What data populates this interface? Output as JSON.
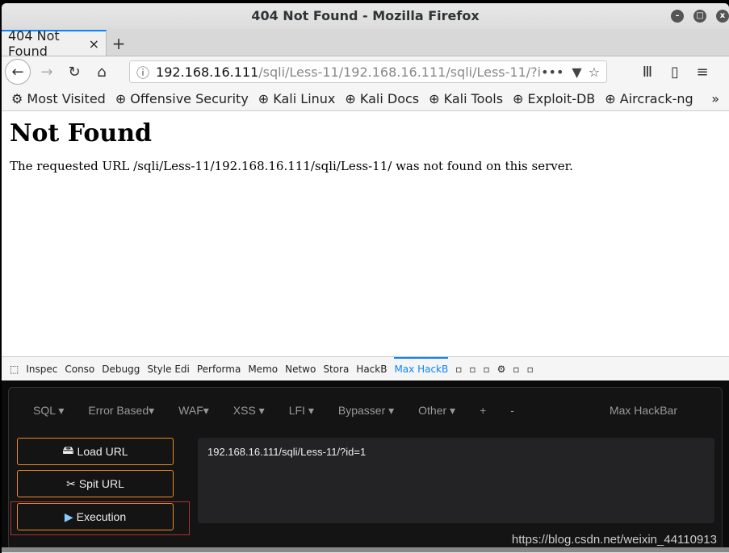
{
  "window": {
    "title": "404 Not Found - Mozilla Firefox"
  },
  "tab": {
    "label": "404 Not Found",
    "close": "×",
    "new": "+"
  },
  "nav": {
    "url_host": "192.168.16.111",
    "url_path": "/sqli/Less-11/192.168.16.111/sqli/Less-11/?i",
    "more": "•••"
  },
  "bookmarks": [
    "Most Visited",
    "Offensive Security",
    "Kali Linux",
    "Kali Docs",
    "Kali Tools",
    "Exploit-DB",
    "Aircrack-ng"
  ],
  "page": {
    "heading": "Not Found",
    "message": "The requested URL /sqli/Less-11/192.168.16.111/sqli/Less-11/ was not found on this server."
  },
  "devtools": {
    "tabs": [
      "Inspec",
      "Conso",
      "Debugg",
      "Style Edi",
      "Performa",
      "Memo",
      "Netwo",
      "Stora",
      "HackB",
      "Max HackB"
    ],
    "active": "Max HackB"
  },
  "hackbar": {
    "menu": [
      "SQL ▾",
      "Error Based▾",
      "WAF▾",
      "XSS ▾",
      "LFI ▾",
      "Bypasser ▾",
      "Other ▾",
      "+",
      "-"
    ],
    "brand": "Max HackBar",
    "load_url": "Load URL",
    "split_url": "Spit URL",
    "execution": "Execution",
    "url_value": "192.168.16.111/sqli/Less-11/?id=1"
  },
  "watermark": "https://blog.csdn.net/weixin_44110913",
  "colors": {
    "accent": "#0a84ff",
    "button_border": "#f08a24",
    "highlight": "#aa3333"
  }
}
